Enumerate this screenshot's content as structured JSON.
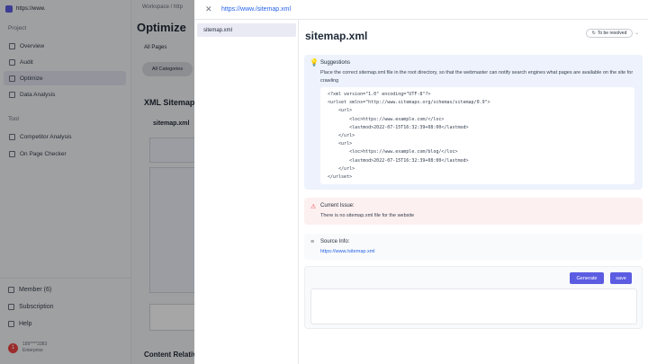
{
  "sidebar": {
    "site": "https://www.",
    "section_project": "Project",
    "items": [
      {
        "label": "Overview",
        "active": false
      },
      {
        "label": "Audit",
        "active": false
      },
      {
        "label": "Optimize",
        "active": true
      },
      {
        "label": "Data Analysis",
        "active": false
      }
    ],
    "section_tool": "Tool",
    "tools": [
      {
        "label": "Competitor Analysis"
      },
      {
        "label": "On Page Checker"
      }
    ],
    "member": "Member (6)",
    "subscription": "Subscription",
    "help": "Help",
    "user_initial": "1",
    "user_phone": "189****3383",
    "user_plan": "Enterprise"
  },
  "background": {
    "breadcrumb": "Workspace  /  http",
    "title": "Optimize",
    "tab": "All Pages",
    "pill": "All Categories",
    "section": "XML Sitemap",
    "subsection": "sitemap.xml",
    "footer": "Content Relativ"
  },
  "drawer": {
    "url": "https://www./sitemap.xml",
    "file": "sitemap.xml",
    "title": "sitemap.xml",
    "status": "To be resolved",
    "suggestions_title": "Suggestions",
    "suggestions_text": "Place the correct sitemap.xml file in the root directory, so that the webmaster can notify search engines what pages are available on the site for crawling",
    "code": "<?xml version=\"1.0\" encoding=\"UTF-8\"?>\n<urlset xmlns=\"http://www.sitemaps.org/schemas/sitemap/0.9\">\n    <url>\n        <loc>https://www.example.com/</loc>\n        <lastmod>2022-07-15T16:32:39+08:00</lastmod>\n    </url>\n    <url>\n        <loc>https://www.example.com/blog/</loc>\n        <lastmod>2022-07-15T16:32:39+08:00</lastmod>\n    </url>\n</urlset>",
    "issue_title": "Current Issue:",
    "issue_text": "There is no sitemap.xml file for the website",
    "source_title": "Source Info:",
    "source_link": "https://www./sitemap.xml",
    "generate": "Generate",
    "save": "save"
  }
}
